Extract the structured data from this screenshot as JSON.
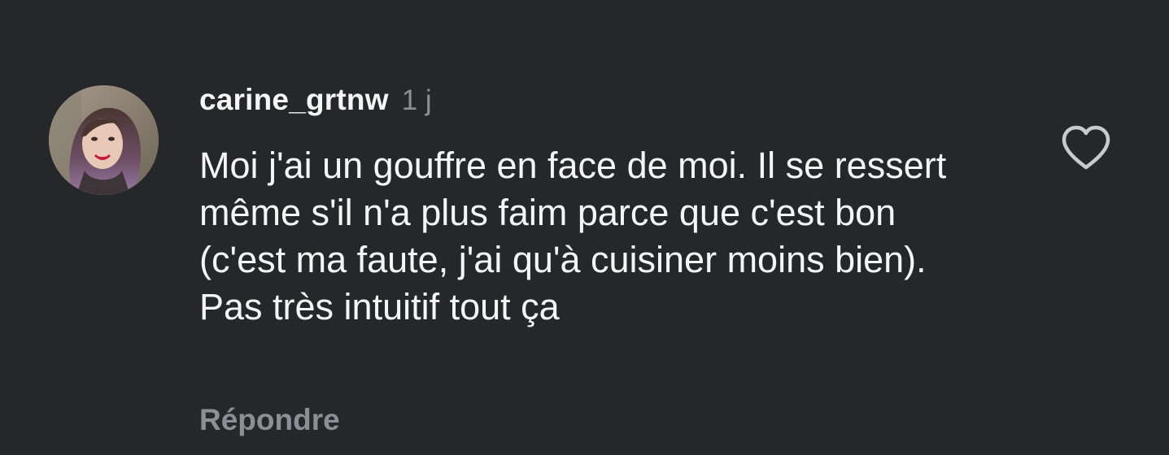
{
  "comment": {
    "username": "carine_grtnw",
    "timestamp": "1 j",
    "text": "Moi j'ai un gouffre en face de moi. Il se ressert même s'il n'a plus faim parce que c'est bon (c'est ma faute, j'ai qu'à cuisiner moins bien). Pas très intuitif tout ça",
    "reply_label": "Répondre",
    "like_icon": "heart-outline-icon"
  },
  "colors": {
    "background": "#25272b",
    "primary_text": "#f5f5f5",
    "secondary_text": "#8c8f94",
    "icon": "#c8cacd"
  }
}
